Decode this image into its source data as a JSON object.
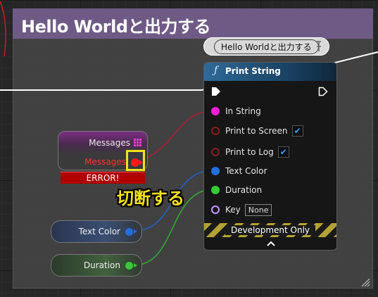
{
  "comment": {
    "title": "Hello Worldと出力する"
  },
  "node_comment": {
    "text": "Hello Worldと出力する"
  },
  "print_string": {
    "title": "Print String",
    "function_glyph": "ƒ",
    "pins": {
      "in_string": "In String",
      "print_to_screen": "Print to Screen",
      "print_to_log": "Print to Log",
      "text_color": "Text Color",
      "duration": "Duration",
      "key": "Key"
    },
    "print_to_screen_checked": true,
    "print_to_log_checked": true,
    "key_value": "None",
    "development_only": "Development Only"
  },
  "messages_node": {
    "title": "Messages",
    "output": "Messages",
    "error": "ERROR!"
  },
  "text_color_node": {
    "label": "Text Color"
  },
  "duration_node": {
    "label": "Duration"
  },
  "annotation": {
    "text": "切断する"
  },
  "colors": {
    "string_pin": "#ff1fd6",
    "bool_pin": "#8a1d1d",
    "color_pin": "#1f6fe0",
    "float_pin": "#33cc33",
    "name_pin": "#c79aff",
    "exec_pin": "#ffffff",
    "error": "#b00000",
    "highlight": "#f1e21a",
    "comment_header": "#6f5a86"
  },
  "icons": {
    "exec_in": "exec-arrow",
    "exec_out": "exec-arrow-outline",
    "array": "grid-3x3",
    "expand": "chevron-up",
    "resize": "resize-grip",
    "pin": "pin"
  }
}
